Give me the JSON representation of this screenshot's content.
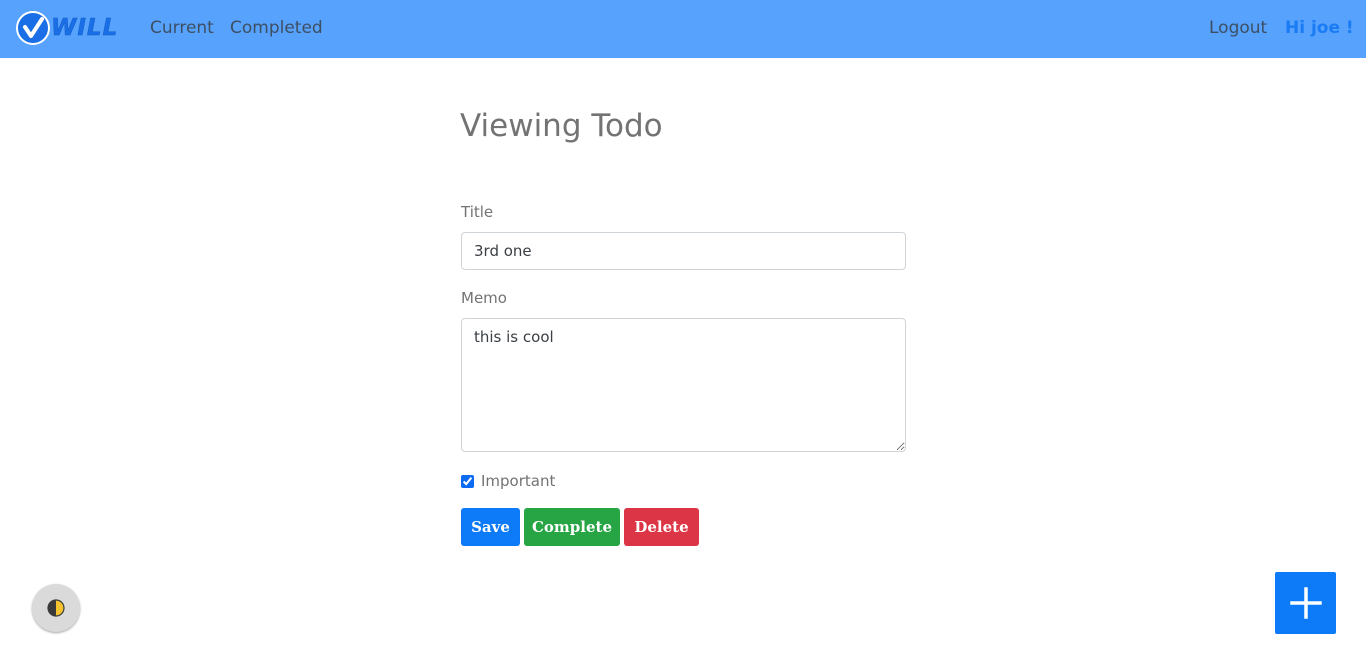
{
  "navbar": {
    "brand_text": "WILL",
    "links": {
      "current": "Current",
      "completed": "Completed",
      "logout": "Logout"
    },
    "greeting": "Hi joe !",
    "background": "#56a2fc"
  },
  "page": {
    "title": "Viewing Todo"
  },
  "form": {
    "title_label": "Title",
    "title_value": "3rd one",
    "memo_label": "Memo",
    "memo_value": "this is cool",
    "important_label": "Important",
    "important_checked": true
  },
  "actions": {
    "save": "Save",
    "complete": "Complete",
    "delete": "Delete"
  },
  "icons": {
    "brand": "checkmark-circle-icon",
    "theme_toggle": "half-moon-icon",
    "fab": "plus-icon"
  },
  "colors": {
    "save": "#0d7bf7",
    "complete": "#27a444",
    "delete": "#dc3545",
    "greeting": "#1a7cf5"
  }
}
